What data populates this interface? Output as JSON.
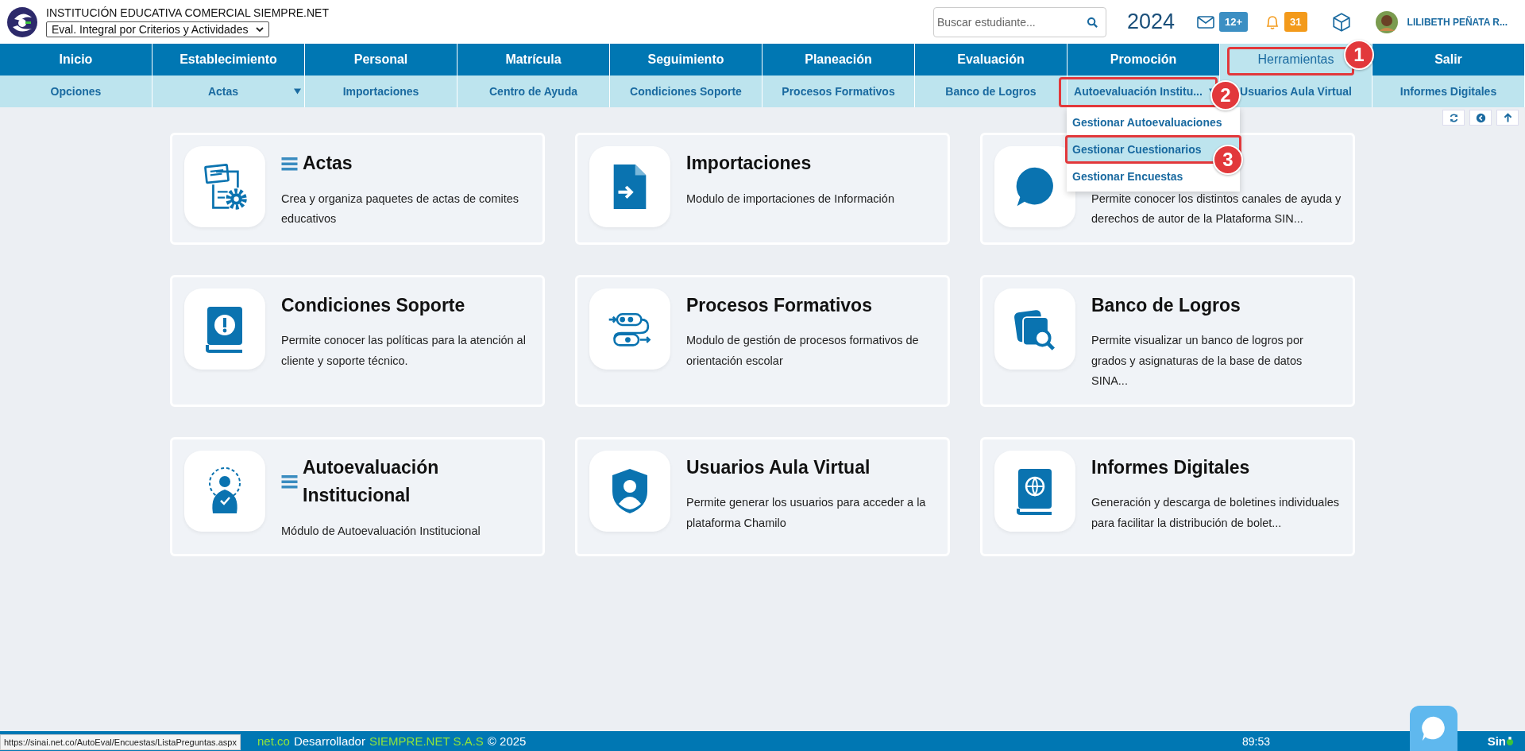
{
  "header": {
    "institution": "INSTITUCIÓN EDUCATIVA COMERCIAL SIEMPRE.NET",
    "mode_select": {
      "value": "Eval. Integral por Criterios y Actividades"
    },
    "search": {
      "placeholder": "Buscar estudiante..."
    },
    "year": "2024",
    "messages_badge": "12+",
    "notifications_badge": "31",
    "user_name": "LILIBETH PEÑATA R..."
  },
  "main_menu": [
    {
      "label": "Inicio",
      "selected": false
    },
    {
      "label": "Establecimiento",
      "selected": false
    },
    {
      "label": "Personal",
      "selected": false
    },
    {
      "label": "Matrícula",
      "selected": false
    },
    {
      "label": "Seguimiento",
      "selected": false
    },
    {
      "label": "Planeación",
      "selected": false
    },
    {
      "label": "Evaluación",
      "selected": false
    },
    {
      "label": "Promoción",
      "selected": false
    },
    {
      "label": "Herramientas",
      "selected": true
    },
    {
      "label": "Salir",
      "selected": false
    }
  ],
  "sub_menu": [
    {
      "label": "Opciones",
      "kind": "link"
    },
    {
      "label": "Actas",
      "kind": "dropdown"
    },
    {
      "label": "Importaciones",
      "kind": "link"
    },
    {
      "label": "Centro de Ayuda",
      "kind": "link"
    },
    {
      "label": "Condiciones Soporte",
      "kind": "link"
    },
    {
      "label": "Procesos Formativos",
      "kind": "link"
    },
    {
      "label": "Banco de Logros",
      "kind": "link"
    },
    {
      "label": "Autoevaluación Institu...",
      "kind": "dropdown"
    },
    {
      "label": "Usuarios Aula Virtual",
      "kind": "link"
    },
    {
      "label": "Informes Digitales",
      "kind": "link"
    }
  ],
  "dropdown": [
    {
      "label": "Gestionar Autoevaluaciones",
      "selected": false
    },
    {
      "label": "Gestionar Cuestionarios",
      "selected": true
    },
    {
      "label": "Gestionar Encuestas",
      "selected": false
    }
  ],
  "cards": [
    {
      "title": "Actas",
      "menu": true,
      "description": "Crea y organiza paquetes de actas de comites educativos"
    },
    {
      "title": "Importaciones",
      "menu": false,
      "description": "Modulo de importaciones de Información"
    },
    {
      "menu": false,
      "description": "Permite conocer los distintos canales de ayuda y derechos de autor de la Plataforma SIN..."
    },
    {
      "title": "Condiciones Soporte",
      "menu": false,
      "description": "Permite conocer las políticas para la atención al cliente y soporte técnico."
    },
    {
      "title": "Procesos Formativos",
      "menu": false,
      "description": "Modulo de gestión de procesos formativos de orientación escolar"
    },
    {
      "title": "Banco de Logros",
      "menu": false,
      "description": "Permite visualizar un banco de logros por grados y asignaturas de la base de datos SINA..."
    },
    {
      "title": "Autoevaluación Institucional",
      "menu": true,
      "description": "Módulo de Autoevaluación Institucional"
    },
    {
      "title": "Usuarios Aula Virtual",
      "menu": false,
      "description": "Permite generar los usuarios para acceder a la plataforma Chamilo"
    },
    {
      "title": "Informes Digitales",
      "menu": false,
      "description": "Generación y descarga de boletines individuales para facilitar la distribución de bolet..."
    }
  ],
  "annotations": [
    {
      "number": "1"
    },
    {
      "number": "2"
    },
    {
      "number": "3"
    }
  ],
  "footer": {
    "site_tail": "net.co",
    "developer_label": "Desarrollador",
    "developer": "SIEMPRE.NET S.A.S",
    "copyright": "© 2025",
    "timer": "89:53",
    "logo": "Sin"
  },
  "status_url": "https://sinai.net.co/AutoEval/Encuestas/ListaPreguntas.aspx"
}
